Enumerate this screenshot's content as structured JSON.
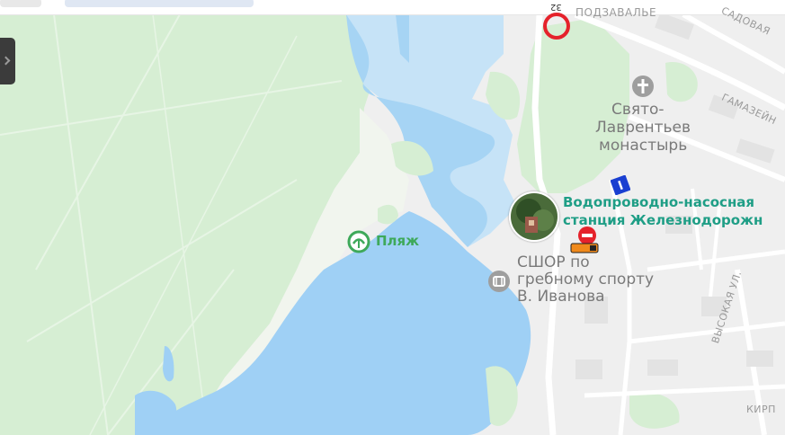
{
  "map": {
    "colors": {
      "forest": "#d6eed3",
      "forest_light": "#e4f3e1",
      "water": "#9fd0f5",
      "water_light": "#c6e3f7",
      "urban": "#efefef",
      "road": "#ffffff"
    },
    "labels": {
      "beach": "Пляж",
      "monastery_line1": "Свято-",
      "monastery_line2": "Лаврентьев",
      "monastery_line3": "монастырь",
      "pump_station_line1": "Водопроводно-насосная",
      "pump_station_line2": "станция Железнодорожн",
      "school_line1": "СШОР по",
      "school_line2": "гребному спорту",
      "school_line3": "В. Иванова",
      "district": "ПОДЗАВАЛЬЕ",
      "street_gamazeyny": "ГАМАЗЕЙН",
      "street_sadovaya": "САДОВАЯ",
      "street_vysokaya": "ВЫСОКАЯ УЛ.",
      "street_kirp": "КИРП",
      "route_number": "32"
    },
    "icons": {
      "beach": "beach-icon",
      "church": "church-icon",
      "stadium": "sports-school-icon",
      "no_entry": "no-entry-sign-icon",
      "one_way": "one-way-sign-icon",
      "road_sign": "red-circle-sign-icon",
      "photo": "photo-thumbnail-icon",
      "expand": "chevron-right-icon"
    }
  }
}
